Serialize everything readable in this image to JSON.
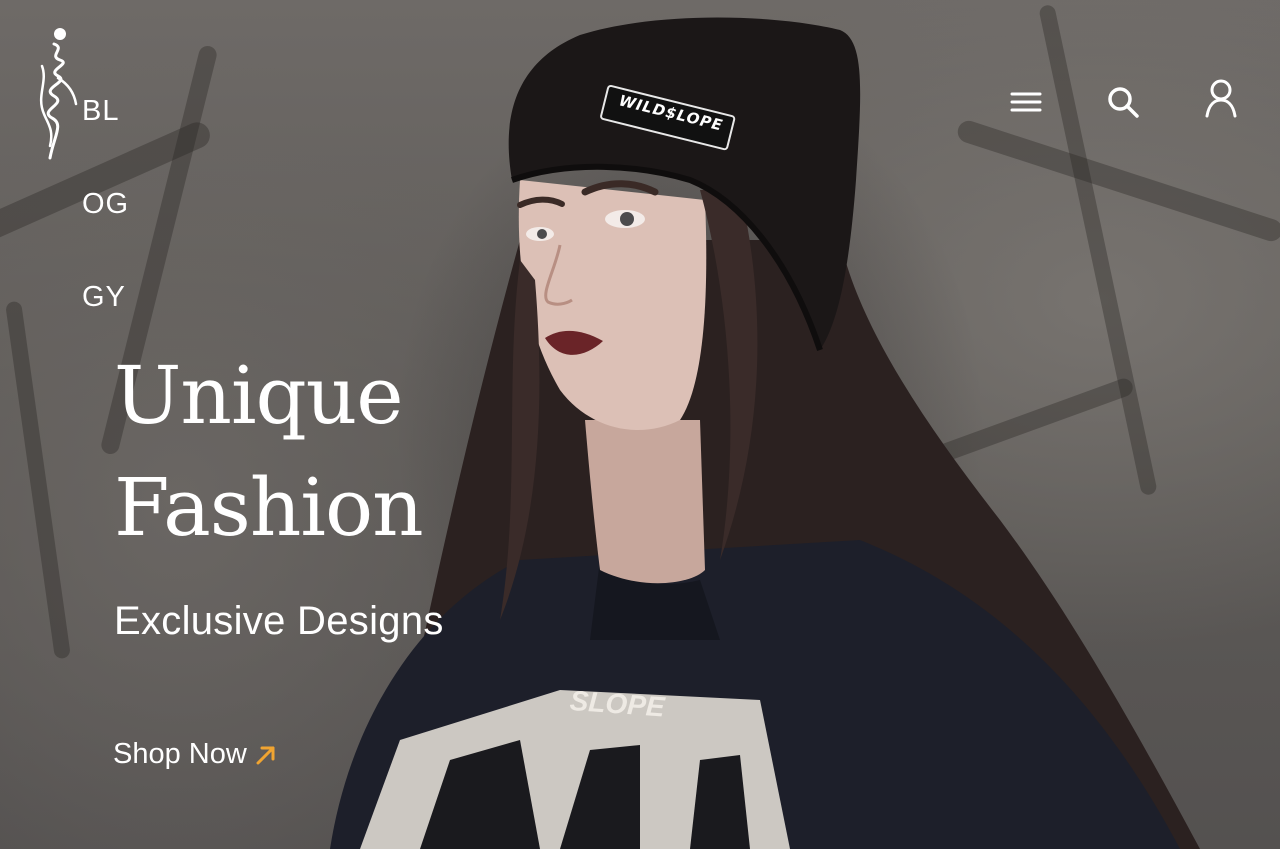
{
  "brand": {
    "logo_lines": [
      "BL",
      "OG",
      "GY"
    ]
  },
  "nav": {
    "menu_icon": "hamburger-menu-icon",
    "search_icon": "search-icon",
    "account_icon": "user-icon"
  },
  "hero": {
    "headline_line1": "Unique",
    "headline_line2": "Fashion",
    "subheadline": "Exclusive Designs",
    "cta_label": "Shop Now",
    "cta_icon": "arrow-up-right-icon",
    "beanie_text": "WILD$LOPE"
  },
  "colors": {
    "text": "#ffffff",
    "accent": "#f0a431"
  }
}
